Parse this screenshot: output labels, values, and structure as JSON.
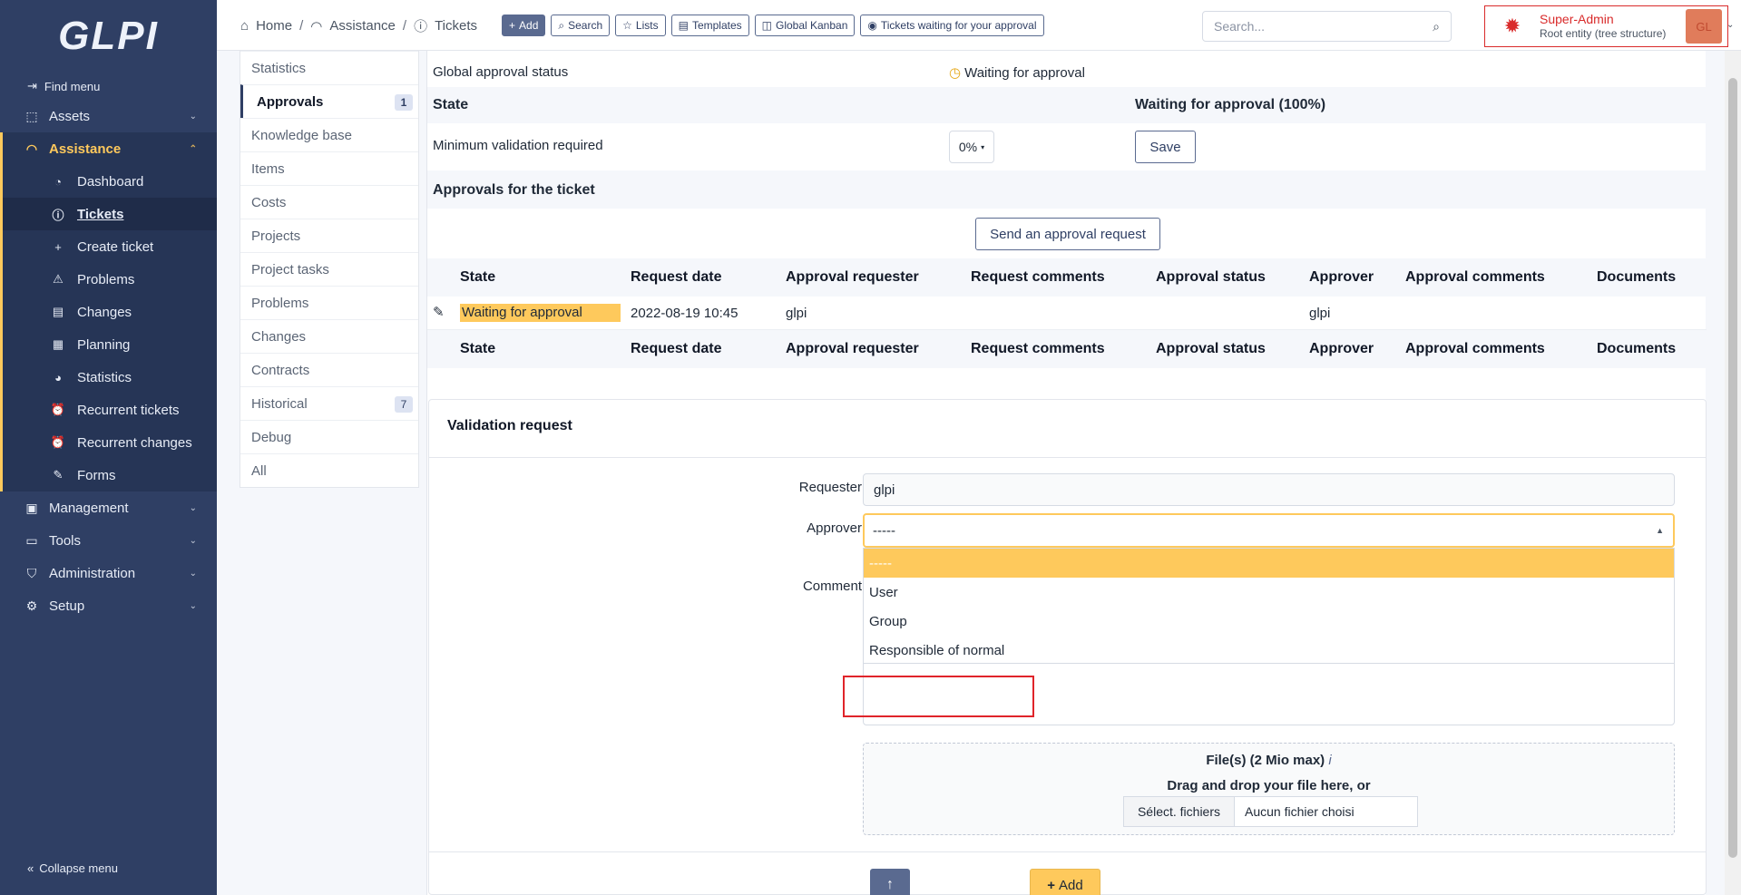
{
  "sidebar": {
    "logo": "GLPI",
    "find_menu": "Find menu",
    "items": [
      {
        "label": "Assets"
      },
      {
        "label": "Assistance"
      },
      {
        "label": "Management"
      },
      {
        "label": "Tools"
      },
      {
        "label": "Administration"
      },
      {
        "label": "Setup"
      }
    ],
    "subitems": [
      {
        "label": "Dashboard"
      },
      {
        "label": "Tickets"
      },
      {
        "label": "Create ticket"
      },
      {
        "label": "Problems"
      },
      {
        "label": "Changes"
      },
      {
        "label": "Planning"
      },
      {
        "label": "Statistics"
      },
      {
        "label": "Recurrent tickets"
      },
      {
        "label": "Recurrent changes"
      },
      {
        "label": "Forms"
      }
    ],
    "collapse": "Collapse menu"
  },
  "header": {
    "breadcrumb": [
      "Home",
      "Assistance",
      "Tickets"
    ],
    "buttons": [
      "Add",
      "Search",
      "Lists",
      "Templates",
      "Global Kanban",
      "Tickets waiting for your approval"
    ],
    "search_placeholder": "Search...",
    "user_name": "Super-Admin",
    "user_entity": "Root entity (tree structure)",
    "avatar": "GL"
  },
  "tabs": [
    {
      "label": "Statistics"
    },
    {
      "label": "Approvals",
      "badge": "1"
    },
    {
      "label": "Knowledge base"
    },
    {
      "label": "Items"
    },
    {
      "label": "Costs"
    },
    {
      "label": "Projects"
    },
    {
      "label": "Project tasks"
    },
    {
      "label": "Problems"
    },
    {
      "label": "Changes"
    },
    {
      "label": "Contracts"
    },
    {
      "label": "Historical",
      "badge": "7"
    },
    {
      "label": "Debug"
    },
    {
      "label": "All"
    }
  ],
  "approval": {
    "global_label": "Global approval status",
    "global_value": "Waiting for approval",
    "state_label": "State",
    "state_value": "Waiting for approval (100%)",
    "min_label": "Minimum validation required",
    "min_value": "0%",
    "save": "Save",
    "section_title": "Approvals for the ticket",
    "send_request": "Send an approval request"
  },
  "table": {
    "headers": [
      "State",
      "Request date",
      "Approval requester",
      "Request comments",
      "Approval status",
      "Approver",
      "Approval comments",
      "Documents"
    ],
    "row": {
      "state": "Waiting for approval",
      "date": "2022-08-19 10:45",
      "requester": "glpi",
      "approver": "glpi"
    }
  },
  "validation": {
    "title": "Validation request",
    "requester_label": "Requester",
    "requester_value": "glpi",
    "approver_label": "Approver",
    "approver_value": "-----",
    "comment_label": "Comment",
    "options": [
      "-----",
      "User",
      "Group",
      "Responsible of normal"
    ],
    "file_title": "File(s) (2 Mio max)",
    "file_info": "i",
    "file_sub": "Drag and drop your file here, or",
    "choose_files": "Sélect. fichiers",
    "no_file": "Aucun fichier choisi",
    "add": "Add"
  }
}
